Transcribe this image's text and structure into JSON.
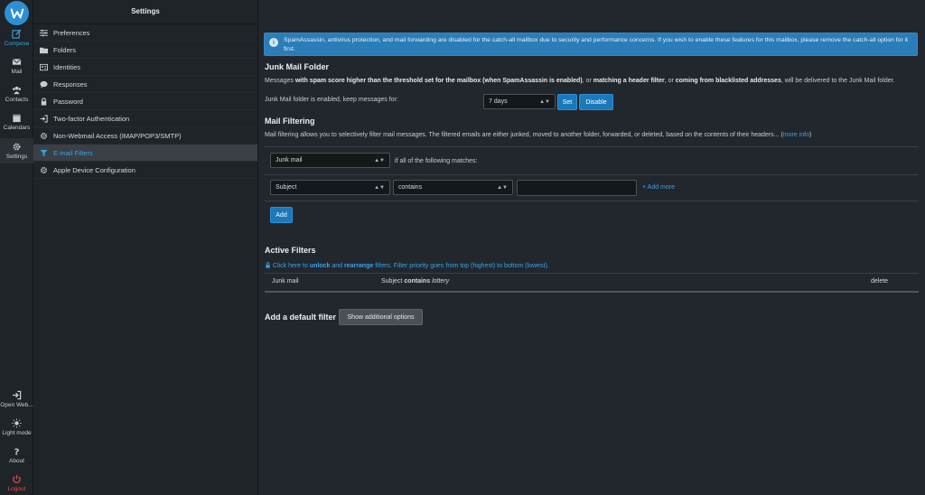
{
  "rail": {
    "items": [
      {
        "label": "Compose",
        "icon": "compose-icon"
      },
      {
        "label": "Mail",
        "icon": "mail-icon"
      },
      {
        "label": "Contacts",
        "icon": "contacts-icon"
      },
      {
        "label": "Calendars",
        "icon": "calendar-icon"
      },
      {
        "label": "Settings",
        "icon": "gear-icon"
      }
    ],
    "bottom": [
      {
        "label": "Open Web...",
        "icon": "sign-in-icon"
      },
      {
        "label": "Light mode",
        "icon": "sun-icon"
      },
      {
        "label": "About",
        "icon": "question-icon"
      },
      {
        "label": "Logout",
        "icon": "power-icon"
      }
    ]
  },
  "settings": {
    "title": "Settings",
    "items": [
      {
        "label": "Preferences",
        "icon": "sliders-icon"
      },
      {
        "label": "Folders",
        "icon": "folder-icon"
      },
      {
        "label": "Identities",
        "icon": "id-card-icon"
      },
      {
        "label": "Responses",
        "icon": "comment-icon"
      },
      {
        "label": "Password",
        "icon": "lock-icon"
      },
      {
        "label": "Two-factor Authentication",
        "icon": "sign-in-icon"
      },
      {
        "label": "Non-Webmail Access (IMAP/POP3/SMTP)",
        "icon": "gear-icon"
      },
      {
        "label": "E-mail Filters",
        "icon": "filter-icon"
      },
      {
        "label": "Apple Device Configuration",
        "icon": "gear-icon"
      }
    ]
  },
  "notice": {
    "text": "SpamAssassin, antivirus protection, and mail forwarding are disabled for the catch-all mailbox due to security and performance concerns. If you wish to enable these features for this mailbox, please remove the catch-all option for it first."
  },
  "junk": {
    "title": "Junk Mail Folder",
    "desc_1": "Messages ",
    "desc_2": "with spam score higher than the threshold set for the mailbox (when SpamAssassin is enabled)",
    "desc_3": ", or ",
    "desc_4": "matching a header filter",
    "desc_5": ", or ",
    "desc_6": "coming from blacklisted addresses",
    "desc_7": ", will be delivered to the Junk Mail folder.",
    "keep_label": "Junk Mail folder is enabled, keep messages for:",
    "keep_value": "7 days",
    "set_label": "Set",
    "disable_label": "Disable"
  },
  "filtering": {
    "title": "Mail Filtering",
    "desc": "Mail filtering allows you to selectively filter mail messages. The filtered emails are either junked, moved to another folder, forwarded, or deleted, based on the contents of their headers... (",
    "more_info": "more info",
    "desc_end": ")",
    "action_value": "Junk mail",
    "match_text": "if all of the following matches:",
    "field_value": "Subject",
    "op_value": "contains",
    "add_more": "+ Add more",
    "add_label": "Add"
  },
  "active": {
    "title": "Active Filters",
    "hint_1": "Click here to ",
    "hint_unlock": "unlock",
    "hint_2": " and ",
    "hint_rearrange": "rearrange",
    "hint_3": " filters. Filter priority goes from top (highest) to bottom (lowest).",
    "rows": [
      {
        "action": "Junk mail",
        "cond_field": "Subject",
        "cond_op": "contains",
        "cond_value": "lottery",
        "delete": "delete"
      }
    ]
  },
  "default_filter": {
    "title": "Add a default filter",
    "button": "Show additional options"
  },
  "colors": {
    "accent": "#2f8fd6",
    "link": "#3aa3e3",
    "logout": "#e04b4b",
    "background": "#22272e"
  }
}
